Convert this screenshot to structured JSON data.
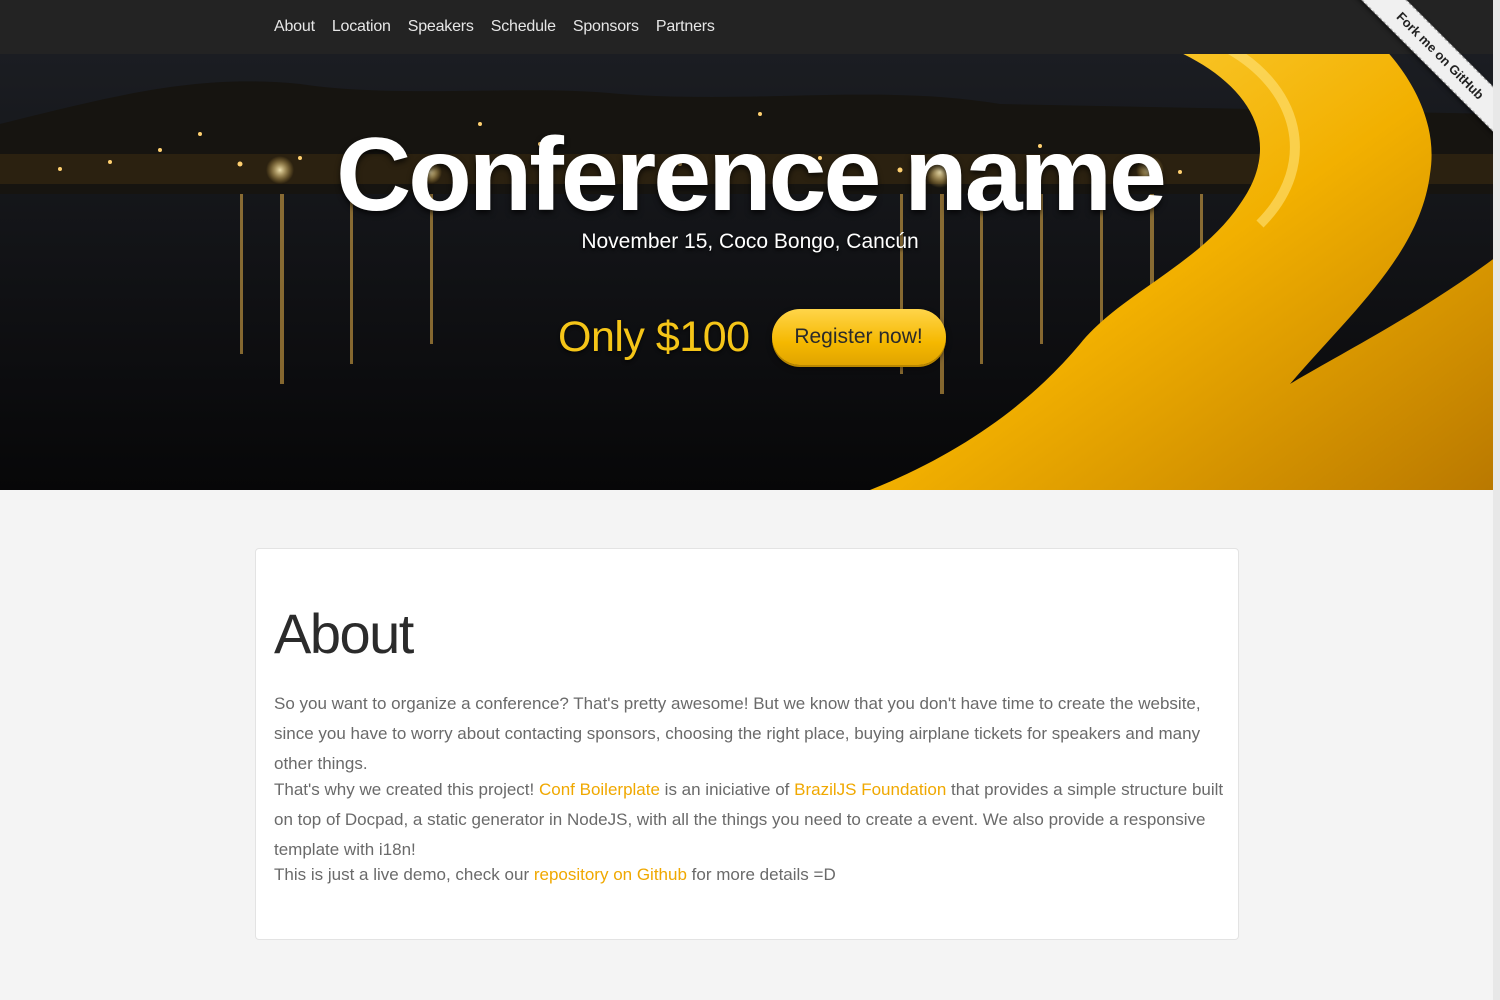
{
  "nav": {
    "items": [
      "About",
      "Location",
      "Speakers",
      "Schedule",
      "Sponsors",
      "Partners"
    ]
  },
  "hero": {
    "title": "Conference name",
    "subtitle": "November 15, Coco Bongo, Cancún",
    "price": "Only $100",
    "register_label": "Register now!"
  },
  "ribbon": {
    "label": "Fork me on GitHub"
  },
  "about": {
    "heading": "About",
    "p1": "So you want to organize a conference? That's pretty awesome! But we know that you don't have time to create the website, since you have to worry about contacting sponsors, choosing the right place, buying airplane tickets for speakers and many other things.",
    "p2_before": "That's why we created this project! ",
    "p2_link1": "Conf Boilerplate",
    "p2_mid": " is an iniciative of ",
    "p2_link2": "BrazilJS Foundation",
    "p2_after": " that provides a simple structure built on top of Docpad, a static generator in NodeJS, with all the things you need to create a event. We also provide a responsive template with i18n!",
    "p3_before": "This is just a live demo, check our ",
    "p3_link": "repository on Github",
    "p3_after": " for more details =D"
  },
  "colors": {
    "accent": "#f0a800",
    "nav_bg": "#232323",
    "button": "#f5b800"
  }
}
